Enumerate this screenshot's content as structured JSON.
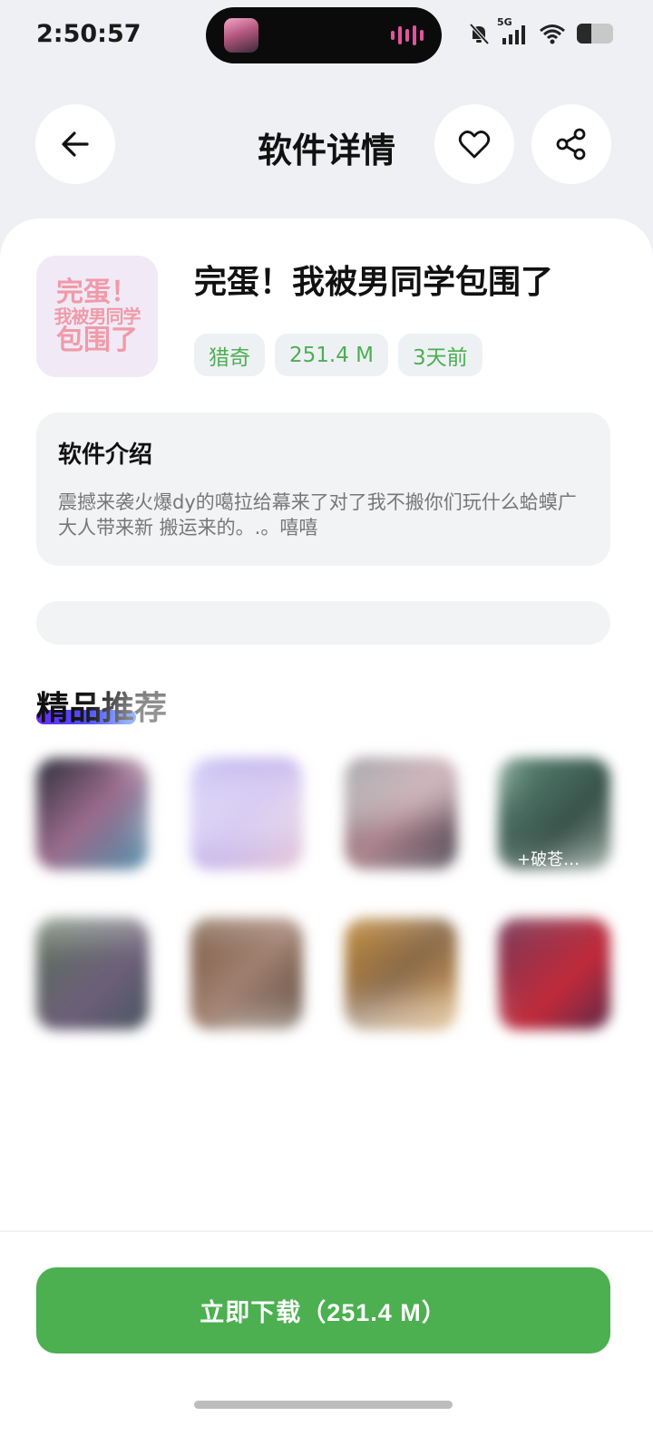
{
  "status_bar": {
    "time": "2:50:57",
    "network": "5G"
  },
  "header": {
    "title": "软件详情"
  },
  "app": {
    "name": "完蛋！我被男同学包围了",
    "icon_text": [
      "完蛋！",
      "我被男同学",
      "包围了"
    ],
    "tags": [
      "猎奇",
      "251.4 M",
      "3天前"
    ]
  },
  "intro": {
    "title": "软件介绍",
    "text": "震撼来袭火爆dy的噶拉给幕来了对了我不搬你们玩什么蛤蟆广大人带来新 搬运来的。.。嘻嘻"
  },
  "section": {
    "title": "精品推荐"
  },
  "recommendations": {
    "caption": "+破苍…"
  },
  "download": {
    "label": "立即下载（251.4 M）"
  },
  "colors": {
    "accent_green": "#4caf50",
    "tag_bg": "#eef1f4",
    "section_gradient_start": "#6b2cf5",
    "section_gradient_end": "#2f6bff"
  }
}
